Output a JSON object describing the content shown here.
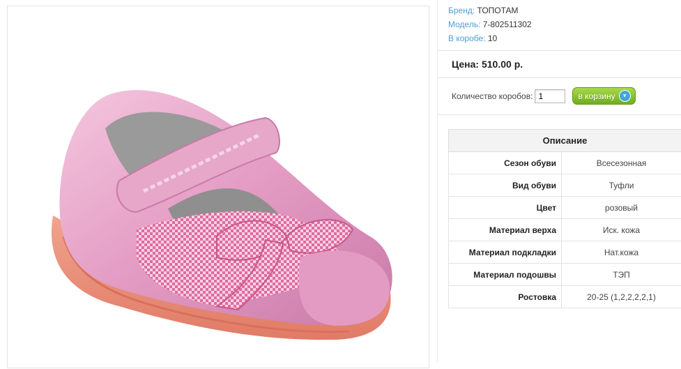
{
  "product": {
    "image_alt": "pink girls shoe"
  },
  "meta": {
    "brand_label": "Бренд:",
    "brand_value": "ТОПОТАМ",
    "model_label": "Модель:",
    "model_value": "7-802511302",
    "box_label": "В коробе:",
    "box_value": "10"
  },
  "price": {
    "text": "Цена: 510.00 р."
  },
  "order": {
    "qty_label": "Количество коробов:",
    "qty_value": "1",
    "cart_button": "в корзину",
    "cart_icon": "basket-icon"
  },
  "spec": {
    "title": "Описание",
    "rows": [
      {
        "key": "Сезон обуви",
        "value": "Всесезонная"
      },
      {
        "key": "Вид обуви",
        "value": "Туфли"
      },
      {
        "key": "Цвет",
        "value": "розовый"
      },
      {
        "key": "Материал верха",
        "value": "Иск. кожа"
      },
      {
        "key": "Материал подкладки",
        "value": "Нат.кожа"
      },
      {
        "key": "Материал подошвы",
        "value": "ТЭП"
      },
      {
        "key": "Ростовка",
        "value": "20-25 (1,2,2,2,2,1)"
      }
    ]
  },
  "colors": {
    "link": "#4a9fd6",
    "button_green": "#7cbf2a",
    "shoe_pink": "#e9a6c8"
  }
}
